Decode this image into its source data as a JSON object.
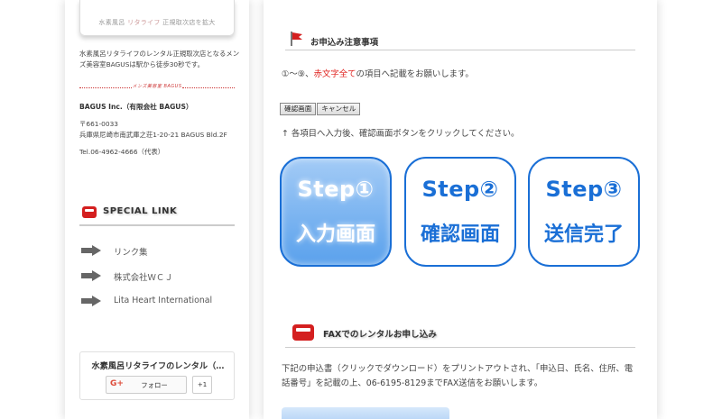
{
  "sidebar": {
    "banner": {
      "part1": "水素風呂",
      "part2": "リタライフ",
      "part3": "正規取次店を拡大"
    },
    "shop_description": "水素風呂リタライフのレンタル正規取次店となるメンズ美容室BAGUSは駅から徒歩30秒です。",
    "divider_logo_text": "メンズ美容室 BAGUS",
    "company_name": "BAGUS Inc.（有限会社 BAGUS）",
    "postal_code": "〒661-0033",
    "address": "兵庫県尼崎市南武庫之荘1-20-21 BAGUS Bld.2F",
    "tel": "Tel.06-4962-4666（代表）",
    "special_link_title": "SPECIAL LINK",
    "links": [
      {
        "label": "リンク集"
      },
      {
        "label": "株式会社ＷＣＪ"
      },
      {
        "label": "Lita Heart International"
      }
    ],
    "gplus": {
      "page_title": "水素風呂リタライフのレンタル（…",
      "g_icon": "G+",
      "follow_label": "フォロー",
      "count": "+1"
    }
  },
  "main": {
    "notice_title": "お申込み注意事項",
    "notice_text_prefix": "①〜⑨、",
    "notice_text_red": "赤文字全て",
    "notice_text_suffix": "の項目へ記載をお願いします。",
    "confirm_button": "確認画面",
    "cancel_button": "キャンセル",
    "instruction": "↑ 各項目へ入力後、確認画面ボタンをクリックしてください。",
    "steps": [
      {
        "label": "Step①",
        "sub": "入力画面",
        "active": true
      },
      {
        "label": "Step②",
        "sub": "確認画面",
        "active": false
      },
      {
        "label": "Step③",
        "sub": "送信完了",
        "active": false
      }
    ],
    "fax_title": "FAXでのレンタルお申し込み",
    "fax_text": "下記の申込書（クリックでダウンロード）をプリントアウトされ、「申込日、氏名、住所、電話番号」を記載の上、06-6195-8129までFAX送信をお願いします。"
  },
  "colors": {
    "accent_blue": "#1a6fd6",
    "alert_red": "#e0231f",
    "icon_red": "#d41f1f"
  }
}
